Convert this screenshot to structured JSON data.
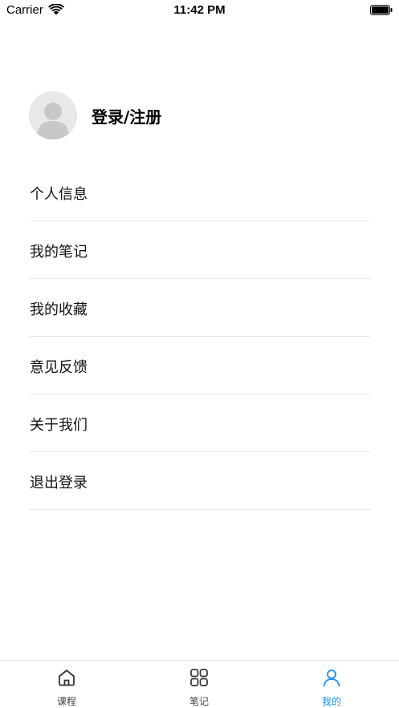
{
  "status_bar": {
    "carrier": "Carrier",
    "time": "11:42 PM"
  },
  "profile": {
    "login_label": "登录/注册"
  },
  "menu": {
    "items": [
      {
        "label": "个人信息"
      },
      {
        "label": "我的笔记"
      },
      {
        "label": "我的收藏"
      },
      {
        "label": "意见反馈"
      },
      {
        "label": "关于我们"
      },
      {
        "label": "退出登录"
      }
    ]
  },
  "tab_bar": {
    "tabs": [
      {
        "label": "课程",
        "icon": "home-icon"
      },
      {
        "label": "笔记",
        "icon": "grid-icon"
      },
      {
        "label": "我的",
        "icon": "person-icon"
      }
    ],
    "active_color": "#1a8ff0",
    "inactive_color": "#444444"
  }
}
